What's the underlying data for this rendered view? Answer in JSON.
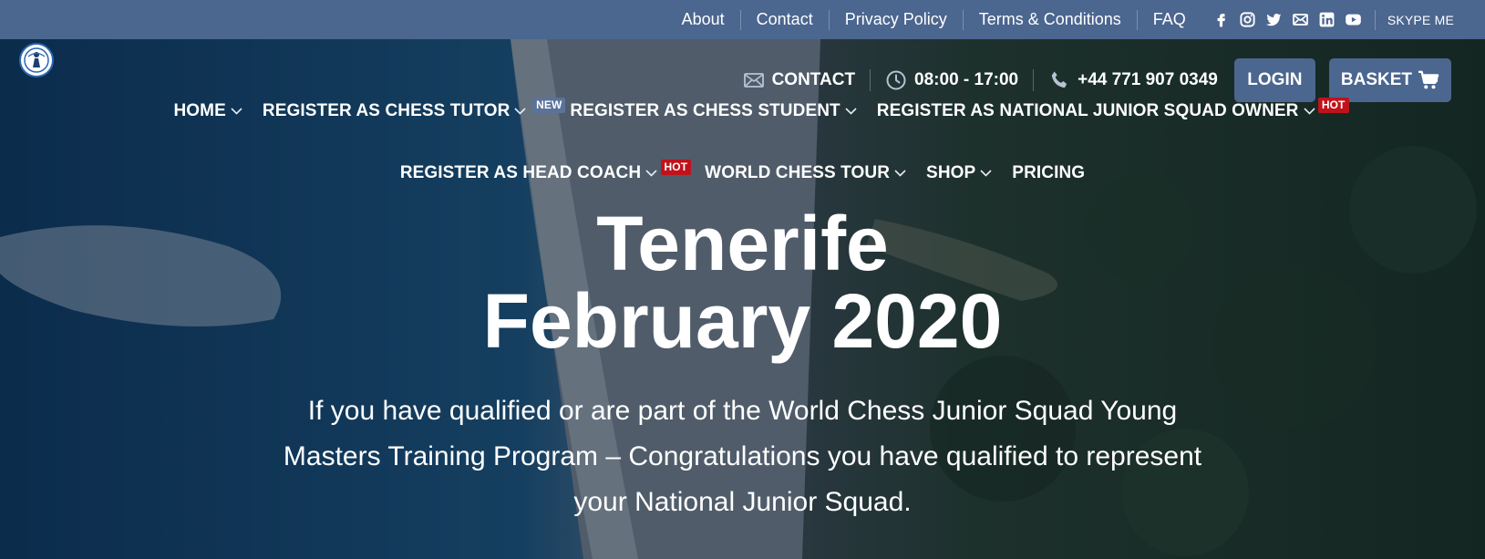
{
  "topbar": {
    "links": [
      "About",
      "Contact",
      "Privacy Policy",
      "Terms & Conditions",
      "FAQ"
    ],
    "social_icons": [
      "facebook-icon",
      "instagram-icon",
      "twitter-icon",
      "mail-icon",
      "linkedin-icon",
      "youtube-icon"
    ],
    "skype_label": "SKYPE ME",
    "background": "#4b668f"
  },
  "contact": {
    "contact_label": "CONTACT",
    "hours": "08:00 - 17:00",
    "phone": "+44 771 907 0349",
    "login_label": "LOGIN",
    "basket_label": "BASKET"
  },
  "nav": {
    "row1": [
      {
        "label": "HOME",
        "dropdown": true,
        "badge": ""
      },
      {
        "label": "REGISTER AS CHESS TUTOR",
        "dropdown": true,
        "badge": "NEW"
      },
      {
        "label": "REGISTER AS CHESS STUDENT",
        "dropdown": true,
        "badge": ""
      },
      {
        "label": "REGISTER AS NATIONAL JUNIOR SQUAD OWNER",
        "dropdown": true,
        "badge": "HOT"
      }
    ],
    "row2": [
      {
        "label": "REGISTER AS HEAD COACH",
        "dropdown": true,
        "badge": "HOT"
      },
      {
        "label": "WORLD CHESS TOUR",
        "dropdown": true,
        "badge": ""
      },
      {
        "label": "SHOP",
        "dropdown": true,
        "badge": ""
      },
      {
        "label": "PRICING",
        "dropdown": false,
        "badge": ""
      }
    ]
  },
  "hero": {
    "title_line1": "Tenerife",
    "title_line2": "February 2020",
    "text": "If you have qualified or are part of the World Chess Junior Squad Young Masters Training Program – Congratulations you have qualified to represent your National Junior Squad."
  },
  "colors": {
    "accent": "#4b668f",
    "badge_new": "#5b7299",
    "badge_hot": "#c0121b"
  }
}
